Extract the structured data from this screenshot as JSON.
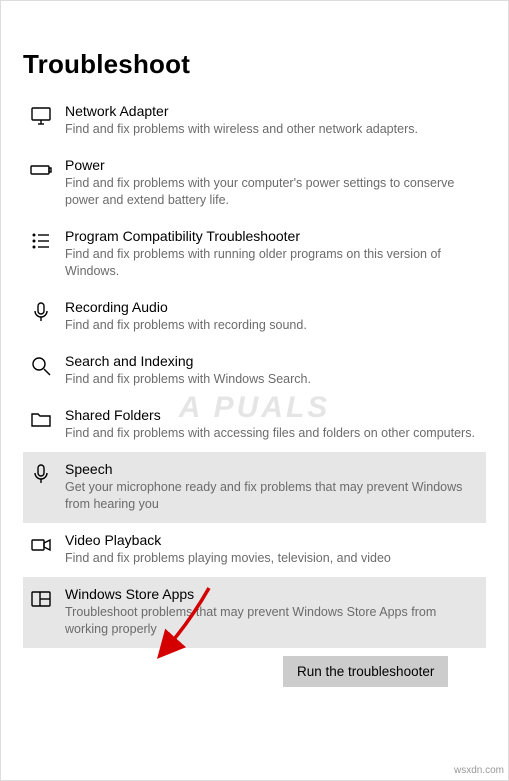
{
  "pageTitle": "Troubleshoot",
  "items": [
    {
      "id": "network-adapter",
      "title": "Network Adapter",
      "desc": "Find and fix problems with wireless and other network adapters.",
      "selected": false
    },
    {
      "id": "power",
      "title": "Power",
      "desc": "Find and fix problems with your computer's power settings to conserve power and extend battery life.",
      "selected": false
    },
    {
      "id": "program-compatibility",
      "title": "Program Compatibility Troubleshooter",
      "desc": "Find and fix problems with running older programs on this version of Windows.",
      "selected": false
    },
    {
      "id": "recording-audio",
      "title": "Recording Audio",
      "desc": "Find and fix problems with recording sound.",
      "selected": false
    },
    {
      "id": "search-indexing",
      "title": "Search and Indexing",
      "desc": "Find and fix problems with Windows Search.",
      "selected": false
    },
    {
      "id": "shared-folders",
      "title": "Shared Folders",
      "desc": "Find and fix problems with accessing files and folders on other computers.",
      "selected": false
    },
    {
      "id": "speech",
      "title": "Speech",
      "desc": "Get your microphone ready and fix problems that may prevent Windows from hearing you",
      "selected": true
    },
    {
      "id": "video-playback",
      "title": "Video Playback",
      "desc": "Find and fix problems playing movies, television, and video",
      "selected": false
    },
    {
      "id": "windows-store-apps",
      "title": "Windows Store Apps",
      "desc": "Troubleshoot problems that may prevent Windows Store Apps from working properly",
      "selected": true
    }
  ],
  "runButtonLabel": "Run the troubleshooter",
  "watermark": "A   PUALS",
  "footer": "wsxdn.com"
}
